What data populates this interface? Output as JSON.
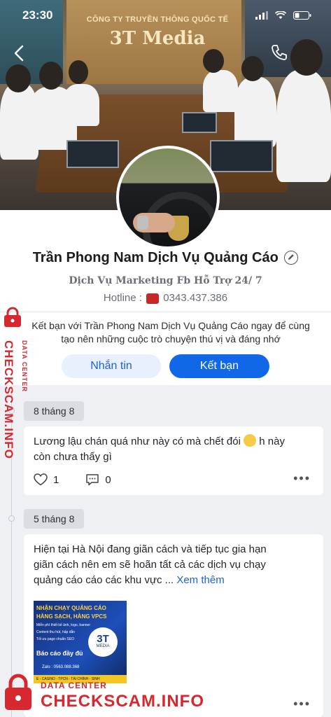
{
  "status_bar": {
    "time": "23:30"
  },
  "cover": {
    "sign_line1": "CÔNG TY TRUYỀN THÔNG QUỐC TẾ",
    "sign_line2": "3T Media"
  },
  "profile": {
    "name": "Trần Phong Nam  Dịch Vụ Quảng Cáo",
    "tagline": "Dịch Vụ Marketing Fb Hỗ Trợ 24/ 7",
    "hotline_label": "Hotline :",
    "hotline_number": "0343.437.386",
    "invite_line1": "Kết bạn với Trần Phong Nam  Dịch Vụ Quảng Cáo ngay để cùng",
    "invite_line2": "tạo nên những cuộc trò chuyện thú vị và đáng nhớ",
    "message_button": "Nhắn tin",
    "add_friend_button": "Kết bạn"
  },
  "posts": [
    {
      "date": "8 tháng 8",
      "text_line1": "Lương lậu chán quá như này có mà chết đói",
      "text_line1b": " h này",
      "text_line2": "còn chưa thấy gì",
      "likes": "1",
      "comments": "0"
    },
    {
      "date": "5 tháng 8",
      "text_line1": "Hiện tại Hà Nội đang giãn cách và tiếp tục gia hạn",
      "text_line2": "giãn cách nên em sẽ hoãn tất cả các dịch vụ chạy",
      "text_line3": "quảng cáo cáo các khu vực ...",
      "see_more": "Xem thêm",
      "image": {
        "title1": "NHẬN CHẠY QUẢNG CÁO",
        "title2": "HÀNG SẠCH, HÀNG VPCS",
        "line1": "Miễn phí thiết kế ảnh, logo, banner",
        "line2": "Content thu hút, hấp dẫn",
        "line3": "Tối ưu page chuẩn SEO",
        "report": "Báo cáo đầy đủ",
        "badge": "3T",
        "badge_sub": "MEDIA",
        "zalo": "Zalo : 0563.088.368",
        "footer": "E - CASINO - TPCN - TÀI CHÍNH - SINH"
      }
    }
  ],
  "watermark": {
    "brand": "CHECKSCAM.INFO",
    "sub": "DATA CENTER"
  },
  "colors": {
    "accent": "#1068e8",
    "accent_light": "#e7f0fc",
    "watermark": "#d7282f"
  }
}
